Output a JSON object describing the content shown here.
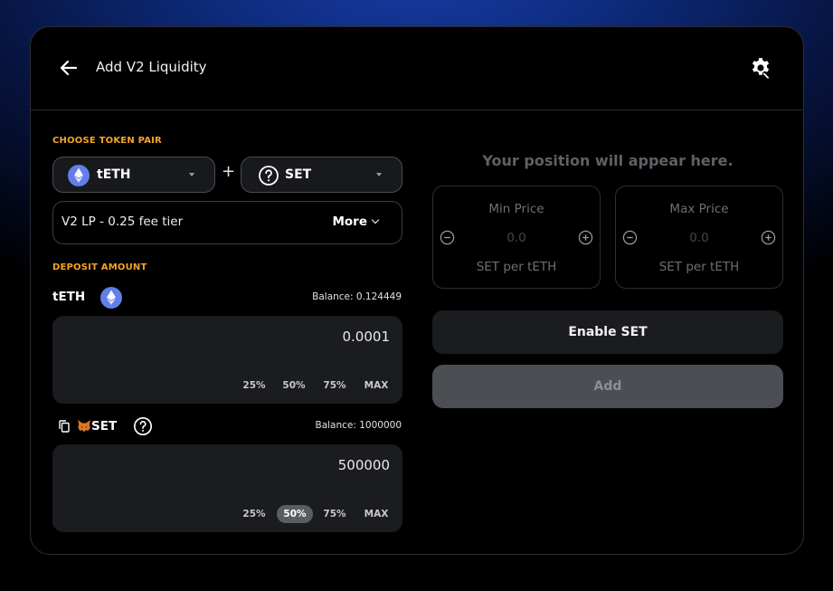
{
  "header": {
    "title": "Add V2 Liquidity"
  },
  "pair": {
    "section_label": "CHOOSE TOKEN PAIR",
    "token_a": "tETH",
    "plus": "+",
    "token_b": "SET",
    "fee_tier": "V2 LP - 0.25 fee tier",
    "more_label": "More"
  },
  "deposit": {
    "section_label": "DEPOSIT AMOUNT",
    "token_a": {
      "symbol": "tETH",
      "balance": "Balance: 0.124449",
      "value": "0.0001",
      "percents": [
        "25%",
        "50%",
        "75%",
        "MAX"
      ]
    },
    "token_b": {
      "symbol": "SET",
      "balance": "Balance: 1000000",
      "value": "500000",
      "percents": [
        "25%",
        "50%",
        "75%",
        "MAX"
      ],
      "active_percent": "50%"
    }
  },
  "position": {
    "message": "Your position will appear here.",
    "min_price": {
      "title": "Min Price",
      "value": "0.0",
      "unit": "SET per tETH"
    },
    "max_price": {
      "title": "Max Price",
      "value": "0.0",
      "unit": "SET per tETH"
    }
  },
  "actions": {
    "enable_label": "Enable SET",
    "add_label": "Add"
  },
  "colors": {
    "accent_label": "#f5a524",
    "eth_icon": "#627eea",
    "background": "#000000"
  },
  "icons": {
    "back": "arrow-left-icon",
    "settings": "gear-icon",
    "eth": "ethereum-icon",
    "unknown_token": "question-circle-icon",
    "copy": "copy-icon",
    "metamask": "metamask-fox-icon",
    "minus": "minus-circle-icon",
    "plus": "plus-circle-icon"
  }
}
